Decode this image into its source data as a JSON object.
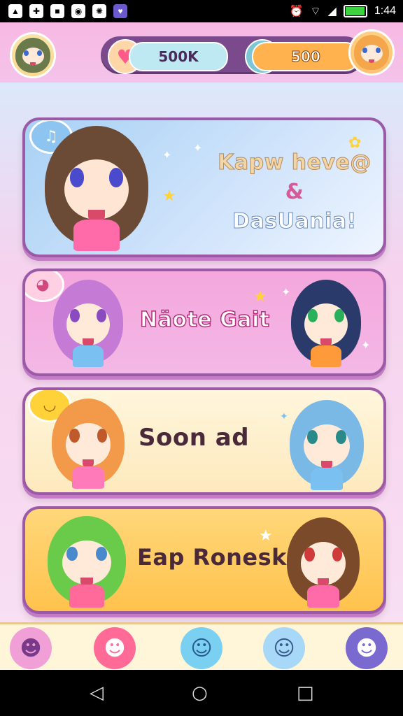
{
  "status_bar": {
    "time": "1:44",
    "battery_level": 0.95,
    "left_icons": [
      "gallery-icon",
      "game-controller-icon",
      "app-icon",
      "steam-icon",
      "pinwheel-icon",
      "shield-icon"
    ],
    "right_icons": [
      "alarm-icon",
      "wifi-icon",
      "signal-icon"
    ]
  },
  "header": {
    "coins": "500K",
    "gems": "500",
    "left_avatar": "player-avatar",
    "right_avatar": "friend-avatar"
  },
  "cards": [
    {
      "title_line1": "Kapw heve@",
      "title_line2": "&",
      "title_line3": "DasUania!",
      "theme": "#a8d1f4"
    },
    {
      "title": "Näote Gait",
      "theme": "#f4a7dc"
    },
    {
      "title": "Soon ad",
      "theme": "#fff6dc"
    },
    {
      "title": "Eap Ronesk",
      "theme": "#ffd77a"
    }
  ],
  "bottom_nav": {
    "items": [
      {
        "icon": "cat-character-icon",
        "label": ""
      },
      {
        "icon": "pink-monster-icon",
        "label": ""
      },
      {
        "icon": "blue-blob-icon",
        "label": ""
      },
      {
        "icon": "ghost-cat-icon",
        "label": ""
      },
      {
        "icon": "purple-ball-icon",
        "label": ""
      }
    ]
  },
  "colors": {
    "accent": "#9a5aa6",
    "header_bar": "#7a4a8c",
    "coin_pill": "#bfe9f2",
    "gem_pill": "#ffb24d"
  }
}
